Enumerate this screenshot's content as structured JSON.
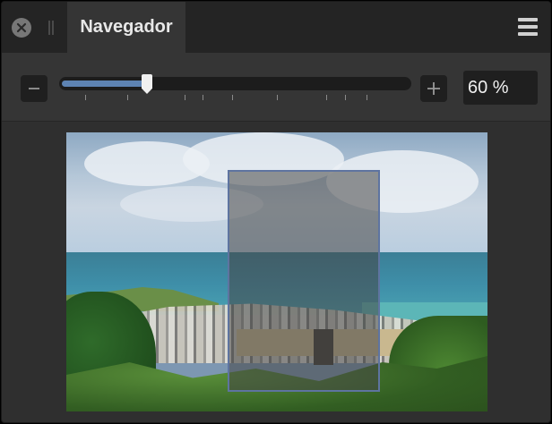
{
  "tabbar": {
    "tab_label": "Navegador",
    "icons": {
      "close": "close-circle-icon",
      "grip": "drag-grip-icon",
      "menu": "hamburger-menu-icon"
    }
  },
  "zoom": {
    "value_text": "60 %",
    "slider_level": 0.25,
    "minus_icon": "minus-icon",
    "plus_icon": "plus-icon"
  },
  "preview": {
    "description_icon": "navigator-thumbnail",
    "viewport_color": "#5e74a0"
  },
  "colors": {
    "accent": "#5d83b3",
    "panel_bg": "#2f2f2f",
    "header_bg": "#242424"
  }
}
